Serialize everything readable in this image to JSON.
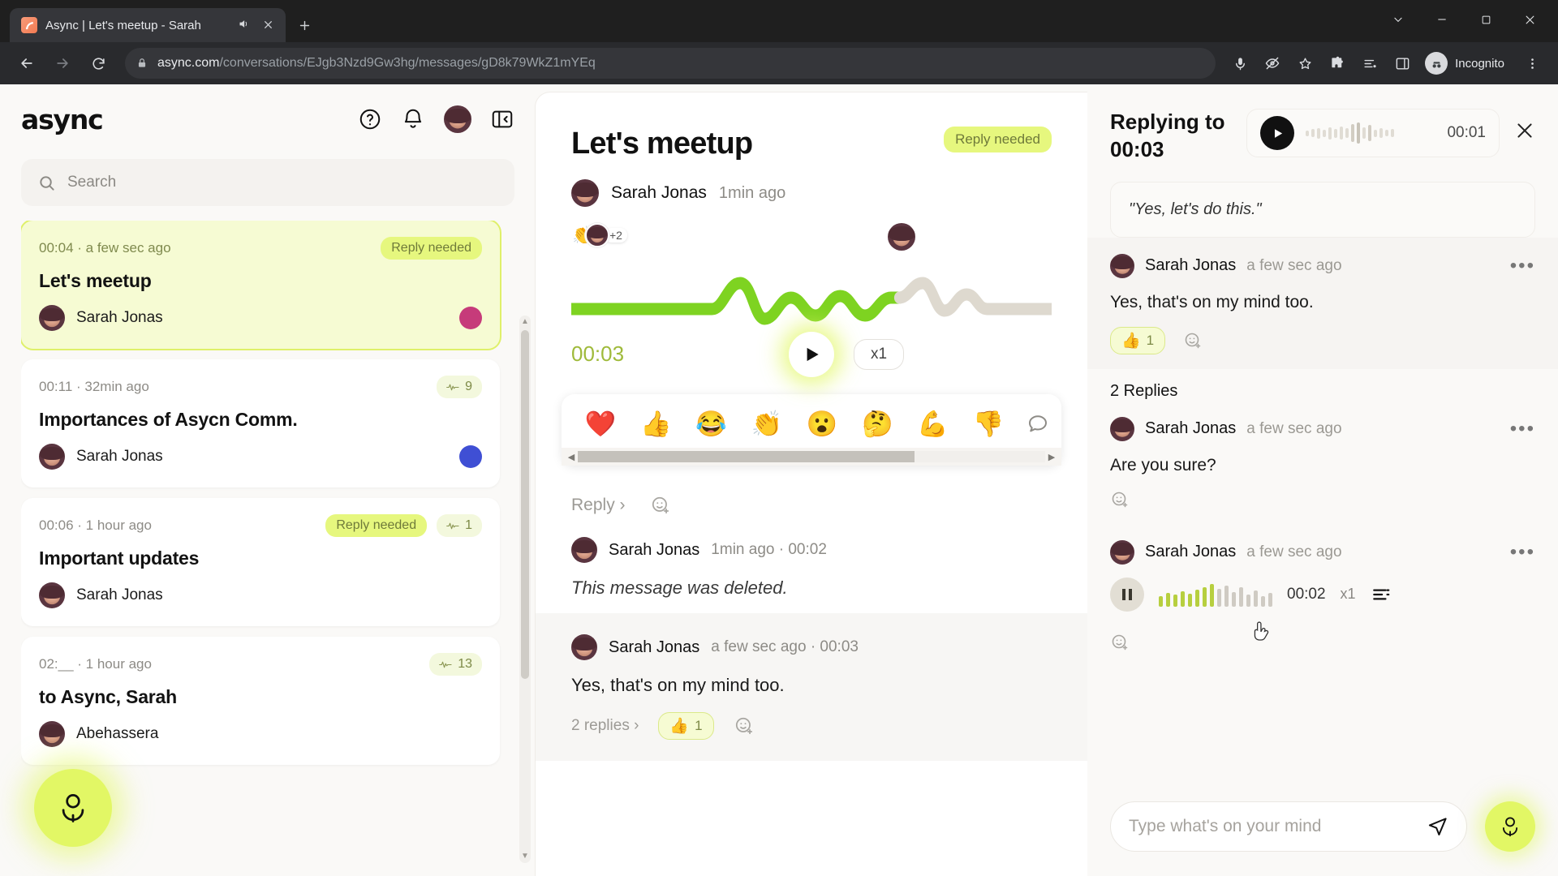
{
  "browser": {
    "tab": {
      "title": "Async | Let's meetup - Sarah",
      "audio_icon": "speaker-icon",
      "close_icon": "close-icon"
    },
    "new_tab_label": "+",
    "window": {
      "minimize": "minimize-icon",
      "maximize": "maximize-icon",
      "close": "close-icon",
      "chevron": "chevron-down-icon"
    },
    "url": {
      "domain": "async.com",
      "path": "/conversations/EJgb3Nzd9Gw3hg/messages/gD8k79WkZ1mYEq"
    },
    "profile": {
      "label": "Incognito"
    },
    "toolbar_icons": [
      "mic-icon",
      "eye-off-icon",
      "star-icon",
      "extensions-icon",
      "reading-list-icon",
      "side-panel-icon",
      "menu-icon"
    ]
  },
  "sidebar": {
    "brand": "async",
    "actions": [
      "help-icon",
      "bell-icon",
      "avatar",
      "collapse-panel-icon"
    ],
    "search": {
      "placeholder": "Search"
    },
    "conversations": [
      {
        "meta": "00:04 · a few sec ago",
        "badge": "Reply needed",
        "count": null,
        "title": "Let's meetup",
        "author": "Sarah Jonas",
        "right_avatar": "pink",
        "active": true
      },
      {
        "meta": "00:11 · 32min ago",
        "badge": null,
        "count": "9",
        "title": "Importances of Asycn Comm.",
        "author": "Sarah Jonas",
        "right_avatar": "blue",
        "active": false
      },
      {
        "meta": "00:06 · 1 hour ago",
        "badge": "Reply needed",
        "count": "1",
        "title": "Important updates",
        "author": "Sarah Jonas",
        "right_avatar": null,
        "active": false
      },
      {
        "meta": "02:__ · 1 hour ago",
        "badge": null,
        "count": "13",
        "title": "to Async, Sarah",
        "author": "Abehassera",
        "right_avatar": null,
        "active": false
      }
    ],
    "record_fab": "mic-icon"
  },
  "main": {
    "title": "Let's meetup",
    "status_pill": "Reply needed",
    "author": "Sarah Jonas",
    "author_time": "1min ago",
    "reactions_preview": {
      "emoji": "👏",
      "overflow": "+2"
    },
    "player": {
      "current_time": "00:03",
      "speed": "x1",
      "play_icon": "play-icon"
    },
    "emoji_picker": [
      "❤️",
      "👍",
      "😂",
      "👏",
      "😮",
      "🤔",
      "💪",
      "👎"
    ],
    "emoji_comment_icon": "comment-icon",
    "reply_link": "Reply ›",
    "add_reaction_icon": "add-reaction-icon",
    "messages": [
      {
        "author": "Sarah Jonas",
        "time": "1min ago · 00:02",
        "body": "This message was deleted.",
        "deleted": true,
        "replies_label": null,
        "reaction": null
      },
      {
        "author": "Sarah Jonas",
        "time": "a few sec ago · 00:03",
        "body": "Yes, that's on my mind too.",
        "deleted": false,
        "replies_label": "2 replies ›",
        "reaction": {
          "emoji": "👍",
          "count": "1"
        }
      }
    ]
  },
  "right_panel": {
    "header_title": "Replying to 00:03",
    "header_audio": {
      "play_icon": "play-icon",
      "time": "00:01"
    },
    "close_icon": "close-icon",
    "quote": "\"Yes, let's do this.\"",
    "parent_message": {
      "author": "Sarah Jonas",
      "time": "a few sec ago",
      "more_icon": "more-horizontal-icon",
      "body": "Yes, that's on my mind too.",
      "reaction": {
        "emoji": "👍",
        "count": "1"
      },
      "add_reaction_icon": "add-reaction-icon"
    },
    "replies_label": "2 Replies",
    "replies": [
      {
        "author": "Sarah Jonas",
        "time": "a few sec ago",
        "more_icon": "more-horizontal-icon",
        "type": "text",
        "body": "Are you sure?",
        "add_reaction_icon": "add-reaction-icon"
      },
      {
        "author": "Sarah Jonas",
        "time": "a few sec ago",
        "more_icon": "more-horizontal-icon",
        "type": "audio",
        "pause_icon": "pause-icon",
        "time_elapsed": "00:02",
        "speed": "x1",
        "transcript_icon": "transcript-icon",
        "add_reaction_icon": "add-reaction-icon"
      }
    ],
    "compose": {
      "placeholder": "Type what's on your mind",
      "send_icon": "send-icon",
      "mic_icon": "mic-icon"
    }
  },
  "colors": {
    "accent": "#e2f765",
    "accent_dark": "#9fba3a",
    "pill_bg": "#e6f77e",
    "active_card": "#f6fbd3"
  }
}
